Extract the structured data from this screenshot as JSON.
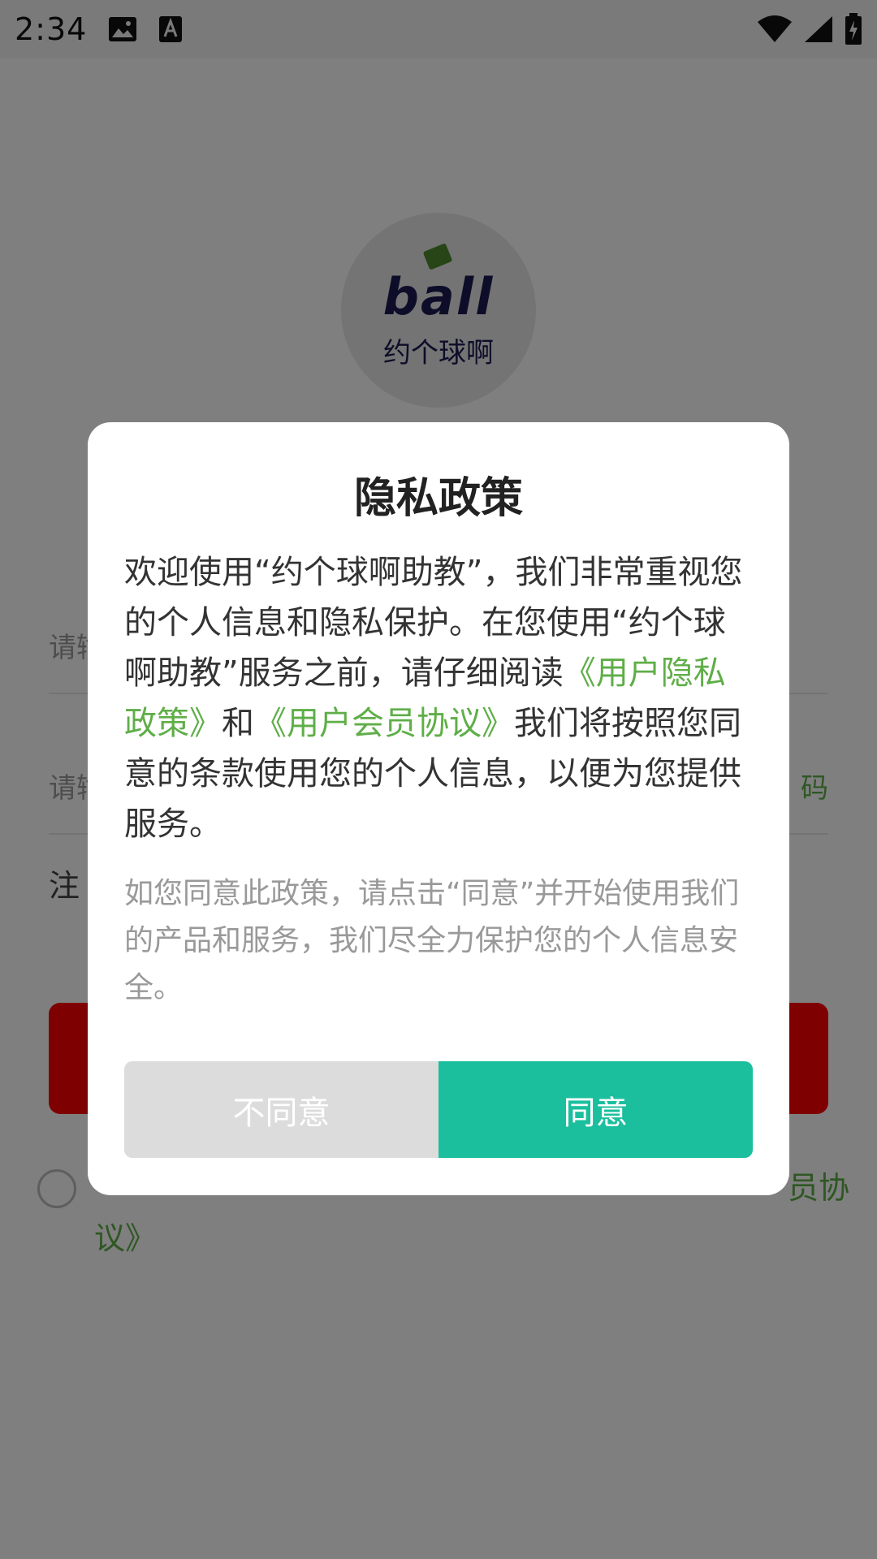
{
  "status_bar": {
    "time": "2:34",
    "icons": [
      "image-icon",
      "text-icon",
      "wifi-icon",
      "signal-icon",
      "battery-charging-icon"
    ]
  },
  "login_page": {
    "logo": {
      "brand": "ball",
      "name": "约个球啊"
    },
    "phone_field": {
      "placeholder": "请输"
    },
    "code_field": {
      "placeholder": "请输",
      "right_link": "码"
    },
    "note": "注",
    "agreement": {
      "text_end": "员协",
      "text_line2": "议》"
    }
  },
  "dialog": {
    "title": "隐私政策",
    "body_part1": "欢迎使用“约个球啊助教”，我们非常重视您的个人信息和隐私保护。在您使用“约个球啊助教”服务之前，请仔细阅读",
    "privacy_link": "《用户隐私政策》",
    "body_and": "和",
    "member_link": "《用户会员协议》",
    "body_part2": "我们将按照您同意的条款使用您的个人信息，以便为您提供服务。",
    "hint": "如您同意此政策，请点击“同意”并开始使用我们的产品和服务，我们尽全力保护您的个人信息安全。",
    "buttons": {
      "disagree": "不同意",
      "agree": "同意"
    }
  },
  "colors": {
    "agree_button": "#1bbf9e",
    "link_green": "#5fae48",
    "login_button_red": "#ff0000",
    "overlay": "rgba(0,0,0,0.5)"
  }
}
